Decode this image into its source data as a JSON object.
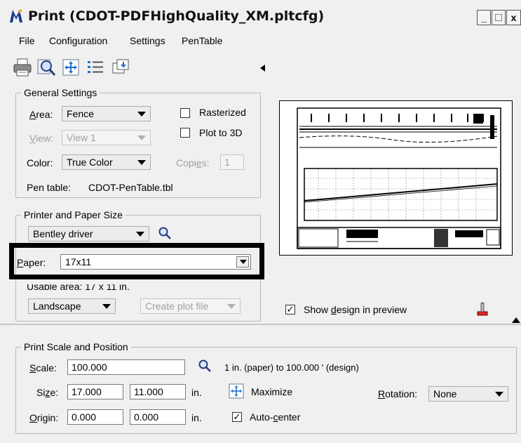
{
  "window": {
    "title": "Print  (CDOT-PDFHighQuality_XM.pltcfg)",
    "minimize": "_",
    "close": "x"
  },
  "menu": {
    "file": "File",
    "configuration": "Configuration",
    "settings": "Settings",
    "pentable": "PenTable"
  },
  "general": {
    "legend": "General Settings",
    "area_label": "Area:",
    "area_value": "Fence",
    "view_label": "View:",
    "view_value": "View 1",
    "color_label": "Color:",
    "color_value": "True Color",
    "rasterized": "Rasterized",
    "plot3d": "Plot to 3D",
    "copies_label": "Copies:",
    "copies_value": "1",
    "pentable_label": "Pen table:",
    "pentable_value": "CDOT-PenTable.tbl"
  },
  "printer": {
    "legend": "Printer and Paper Size",
    "driver": "Bentley driver",
    "paper_label": "Paper:",
    "paper_value": "17x11",
    "usable_area": "Usable area:  17 x 11 in.",
    "orientation": "Landscape",
    "create_plot": "Create plot file"
  },
  "preview": {
    "show_design": "Show design in preview"
  },
  "scale": {
    "legend": "Print Scale and Position",
    "scale_label": "Scale:",
    "scale_value": "100.000",
    "scale_desc": "1 in. (paper) to 100.000 ' (design)",
    "size_label": "Size:",
    "size_w": "17.000",
    "size_h": "11.000",
    "size_unit": "in.",
    "maximize": "Maximize",
    "rotation_label": "Rotation:",
    "rotation_value": "None",
    "origin_label": "Origin:",
    "origin_x": "0.000",
    "origin_y": "0.000",
    "origin_unit": "in.",
    "autocenter": "Auto-center"
  }
}
